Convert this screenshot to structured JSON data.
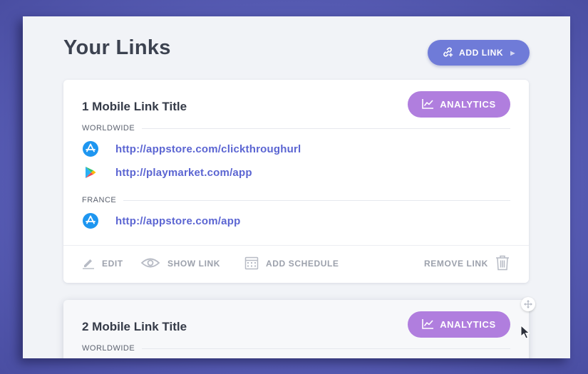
{
  "page": {
    "title": "Your Links"
  },
  "header": {
    "add_link_label": "ADD LINK"
  },
  "colors": {
    "accent": "#6f7bd8",
    "analytics": "#b07ede",
    "link": "#5b65d2"
  },
  "cards": [
    {
      "title": "1 Mobile Link Title",
      "analytics_label": "ANALYTICS",
      "regions": [
        {
          "name": "WORLDWIDE",
          "links": [
            {
              "icon": "app-store-icon",
              "url": "http://appstore.com/clickthroughurl"
            },
            {
              "icon": "google-play-icon",
              "url": "http://playmarket.com/app"
            }
          ]
        },
        {
          "name": "FRANCE",
          "links": [
            {
              "icon": "app-store-icon",
              "url": "http://appstore.com/app"
            }
          ]
        }
      ],
      "actions": {
        "edit": "EDIT",
        "show_link": "SHOW LINK",
        "add_schedule": "ADD SCHEDULE",
        "remove_link": "REMOVE LINK"
      }
    },
    {
      "title": "2 Mobile Link Title",
      "analytics_label": "ANALYTICS",
      "regions": [
        {
          "name": "WORLDWIDE",
          "links": []
        }
      ]
    }
  ]
}
